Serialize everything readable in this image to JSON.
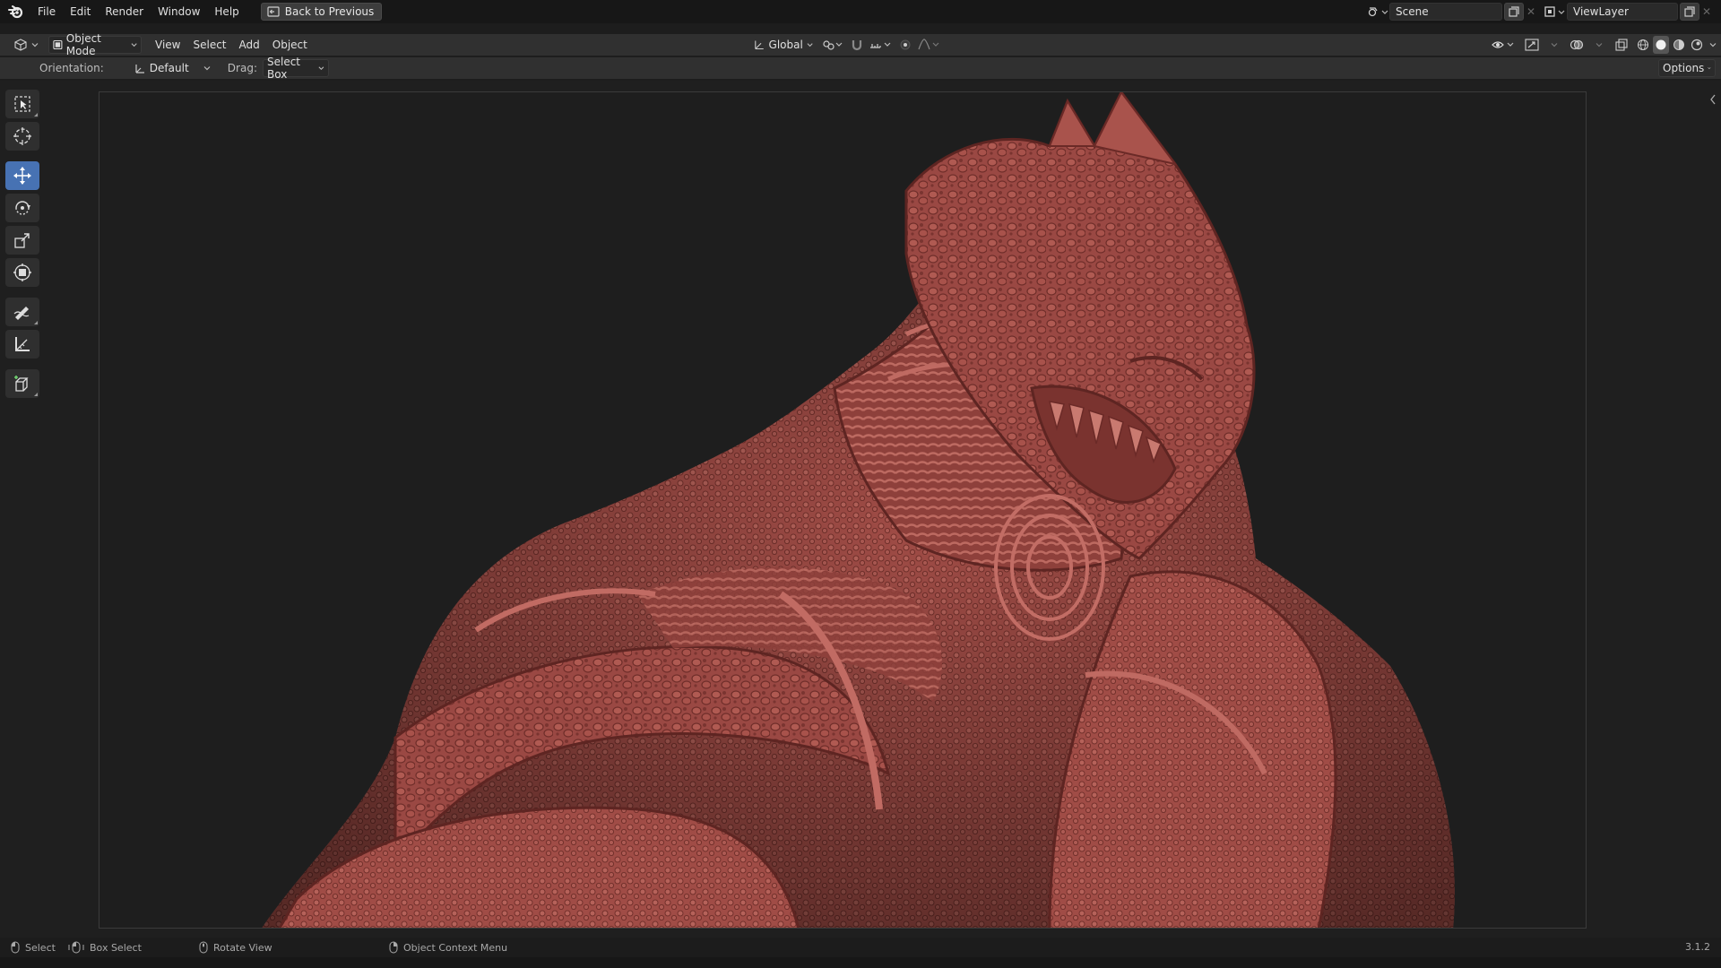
{
  "topbar": {
    "menu": [
      "File",
      "Edit",
      "Render",
      "Window",
      "Help"
    ],
    "back_button": "Back to Previous",
    "scene": "Scene",
    "view_layer": "ViewLayer"
  },
  "header": {
    "mode": "Object Mode",
    "menus": [
      "View",
      "Select",
      "Add",
      "Object"
    ],
    "transform_orientation": "Global"
  },
  "tool_settings": {
    "orientation_label": "Orientation:",
    "orientation_value": "Default",
    "drag_label": "Drag:",
    "drag_value": "Select Box",
    "options_label": "Options"
  },
  "toolbar": {
    "tools": [
      "select-box",
      "cursor",
      "move",
      "rotate",
      "scale",
      "transform",
      "annotate",
      "measure",
      "add-cube"
    ],
    "active": "move"
  },
  "statusbar": {
    "items": [
      "Select",
      "Box Select",
      "Rotate View",
      "Object Context Menu"
    ],
    "version": "3.1.2"
  },
  "colors": {
    "active_tool": "#4772b3",
    "model": "#9c4b45"
  }
}
